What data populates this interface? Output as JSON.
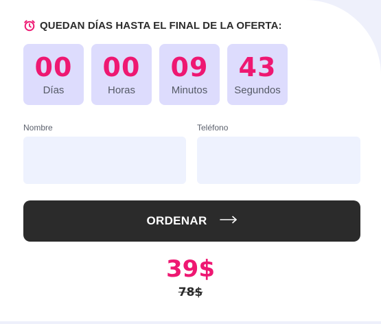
{
  "header": {
    "icon": "alarm-clock-icon",
    "text": "QUEDAN DÍAS HASTA EL FINAL DE LA OFERTA:"
  },
  "countdown": [
    {
      "value": "00",
      "label": "Días"
    },
    {
      "value": "00",
      "label": "Horas"
    },
    {
      "value": "09",
      "label": "Minutos"
    },
    {
      "value": "43",
      "label": "Segundos"
    }
  ],
  "form": {
    "name_label": "Nombre",
    "name_value": "",
    "phone_label": "Teléfono",
    "phone_value": ""
  },
  "order_button": {
    "label": "ORDENAR",
    "icon": "arrow-right-icon"
  },
  "pricing": {
    "current": "39$",
    "old": "78$"
  },
  "colors": {
    "accent": "#ee1872",
    "timer_bg": "#dddcfd",
    "field_bg": "#eef2fe",
    "button_bg": "#2b2b2b",
    "page_bg": "#eef0fb"
  }
}
